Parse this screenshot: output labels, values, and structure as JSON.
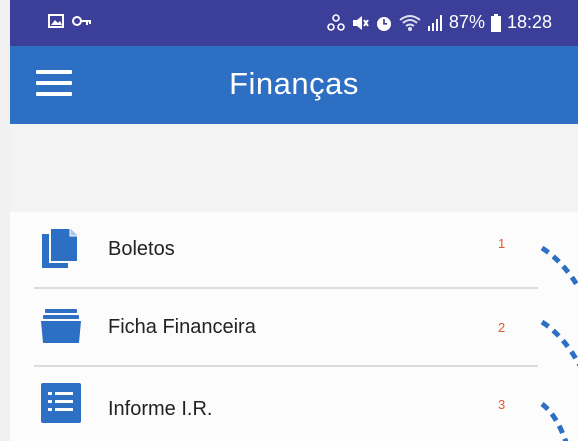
{
  "status_bar": {
    "battery_percent": "87%",
    "time": "18:28",
    "left_icons": [
      "image-icon",
      "key-icon"
    ],
    "right_icons": [
      "network-icon",
      "mute-icon",
      "alarm-icon",
      "wifi-icon",
      "signal-icon",
      "battery-icon"
    ]
  },
  "app_bar": {
    "title": "Finanças",
    "menu_icon": "hamburger-menu-icon"
  },
  "menu_items": [
    {
      "label": "Boletos",
      "number": "1",
      "icon": "document-icon"
    },
    {
      "label": "Ficha Financeira",
      "number": "2",
      "icon": "folder-icon"
    },
    {
      "label": "Informe I.R.",
      "number": "3",
      "icon": "list-icon"
    }
  ],
  "colors": {
    "status_bar": "#3b3f99",
    "app_bar": "#2d6fc2",
    "icon": "#2d6fc2",
    "number_accent": "#e4562b",
    "dashed_line": "#2d6fc2"
  }
}
